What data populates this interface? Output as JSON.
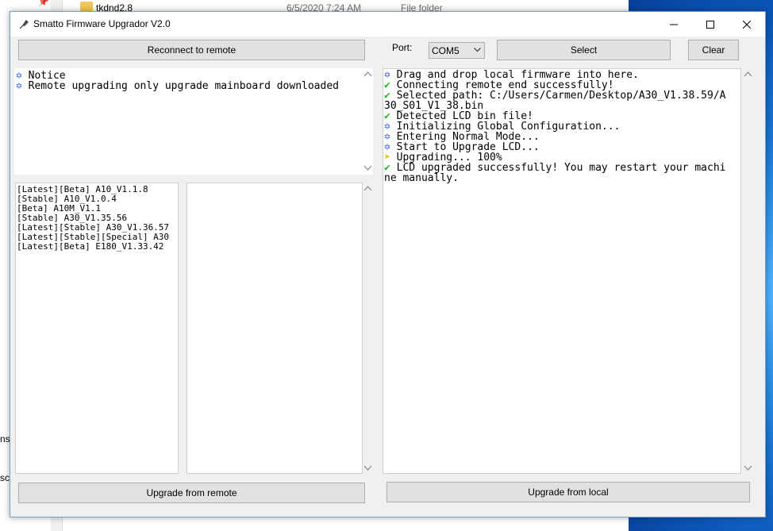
{
  "background": {
    "folder_name": "tkdnd2.8",
    "folder_date": "6/5/2020 7:24 AM",
    "folder_type": "File folder",
    "fragment_1": "ns",
    "fragment_2": "sc"
  },
  "window": {
    "title": "Smatto Firmware Upgrador V2.0",
    "controls": {
      "minimize": "minimize",
      "maximize": "maximize",
      "close": "close"
    }
  },
  "toolbar": {
    "reconnect_label": "Reconnect to remote",
    "port_label": "Port:",
    "port_value": "COM5",
    "select_label": "Select",
    "clear_label": "Clear"
  },
  "notice_log": [
    {
      "icon": "info-icon",
      "glyph": "✡",
      "text": "Notice"
    },
    {
      "icon": "info-icon",
      "glyph": "✡",
      "text": "Remote upgrading only upgrade mainboard downloaded"
    }
  ],
  "firmware_list": [
    "[Latest][Beta] A10_V1.1.8",
    "[Stable] A10_V1.0.4",
    "[Beta] A10M_V1.1",
    "[Stable] A30_V1.35.56",
    "[Latest][Stable] A30_V1.36.57",
    "[Latest][Stable][Special] A30",
    "[Latest][Beta] E180_V1.33.42"
  ],
  "local_log": [
    {
      "icon": "info-icon",
      "glyph": "✡",
      "text": "Drag and drop local firmware into here."
    },
    {
      "icon": "check-icon",
      "glyph": "✔",
      "text": "Connecting remote end successfully!"
    },
    {
      "icon": "check-icon",
      "glyph": "✔",
      "text": "Selected path: C:/Users/Carmen/Desktop/A30_V1.38.59/A"
    },
    {
      "icon": "",
      "glyph": "",
      "text": "30_S01_V1_38.bin"
    },
    {
      "icon": "check-icon",
      "glyph": "✔",
      "text": "Detected LCD bin file!"
    },
    {
      "icon": "info-icon",
      "glyph": "✡",
      "text": "Initializing Global Configuration..."
    },
    {
      "icon": "info-icon",
      "glyph": "✡",
      "text": "Entering Normal Mode..."
    },
    {
      "icon": "info-icon",
      "glyph": "✡",
      "text": "Start to Upgrade LCD..."
    },
    {
      "icon": "progress-icon",
      "glyph": "➤",
      "text": "Upgrading... 100%"
    },
    {
      "icon": "check-icon",
      "glyph": "✔",
      "text": "LCD upgraded successfully! You may restart your machi"
    },
    {
      "icon": "",
      "glyph": "",
      "text": "ne manually."
    }
  ],
  "footer": {
    "upgrade_remote_label": "Upgrade from remote",
    "upgrade_local_label": "Upgrade from local"
  },
  "colors": {
    "info": "#3355ee",
    "success": "#22bb22",
    "progress": "#e8c000"
  }
}
